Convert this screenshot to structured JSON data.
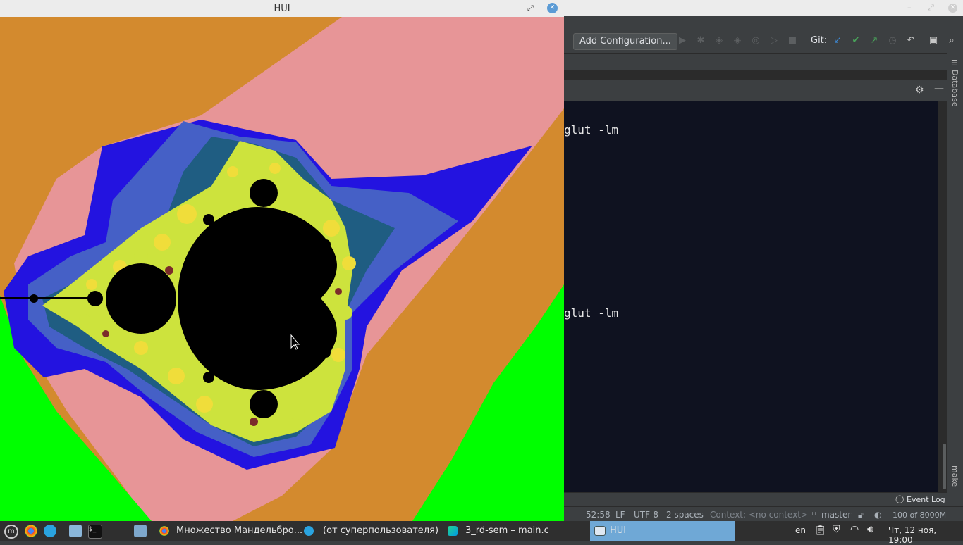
{
  "hui_window": {
    "title": "HUI",
    "controls": {
      "minimize": "–",
      "maximize": "⤢",
      "close": "✕"
    }
  },
  "ide": {
    "toolbar": {
      "add_configuration": "Add Configuration...",
      "git_label": "Git:"
    },
    "terminal_lines": [
      "glut -lm",
      "glut -lm"
    ],
    "side_labels": {
      "database": "Database",
      "make": "make"
    },
    "event_log": "Event Log",
    "status": {
      "position": "52:58",
      "line_sep": "LF",
      "encoding": "UTF-8",
      "indent": "2 spaces",
      "context": "Context: <no context>",
      "branch": "master",
      "memory": "100 of 8000M"
    }
  },
  "taskbar": {
    "tasks": [
      {
        "label": "Множество Мандельбро...",
        "icon": "chrome-icon"
      },
      {
        "label": "(от суперпользователя)",
        "icon": "telegram-icon"
      },
      {
        "label": "3_rd-sem – main.c",
        "icon": "clion-icon"
      },
      {
        "label": "HUI",
        "icon": "window-icon"
      }
    ],
    "lang": "en",
    "clock": "Чт, 12 ноя, 19:00"
  },
  "colors": {
    "orange": "#d38a2e",
    "pink": "#e79597",
    "blue": "#2313e0",
    "steel": "#4560c6",
    "teal": "#1f5d82",
    "lime": "#cde33d",
    "yellow": "#f0dd3a",
    "green": "#00ff00",
    "black": "#000000",
    "active_task": "#6fa8d6"
  }
}
